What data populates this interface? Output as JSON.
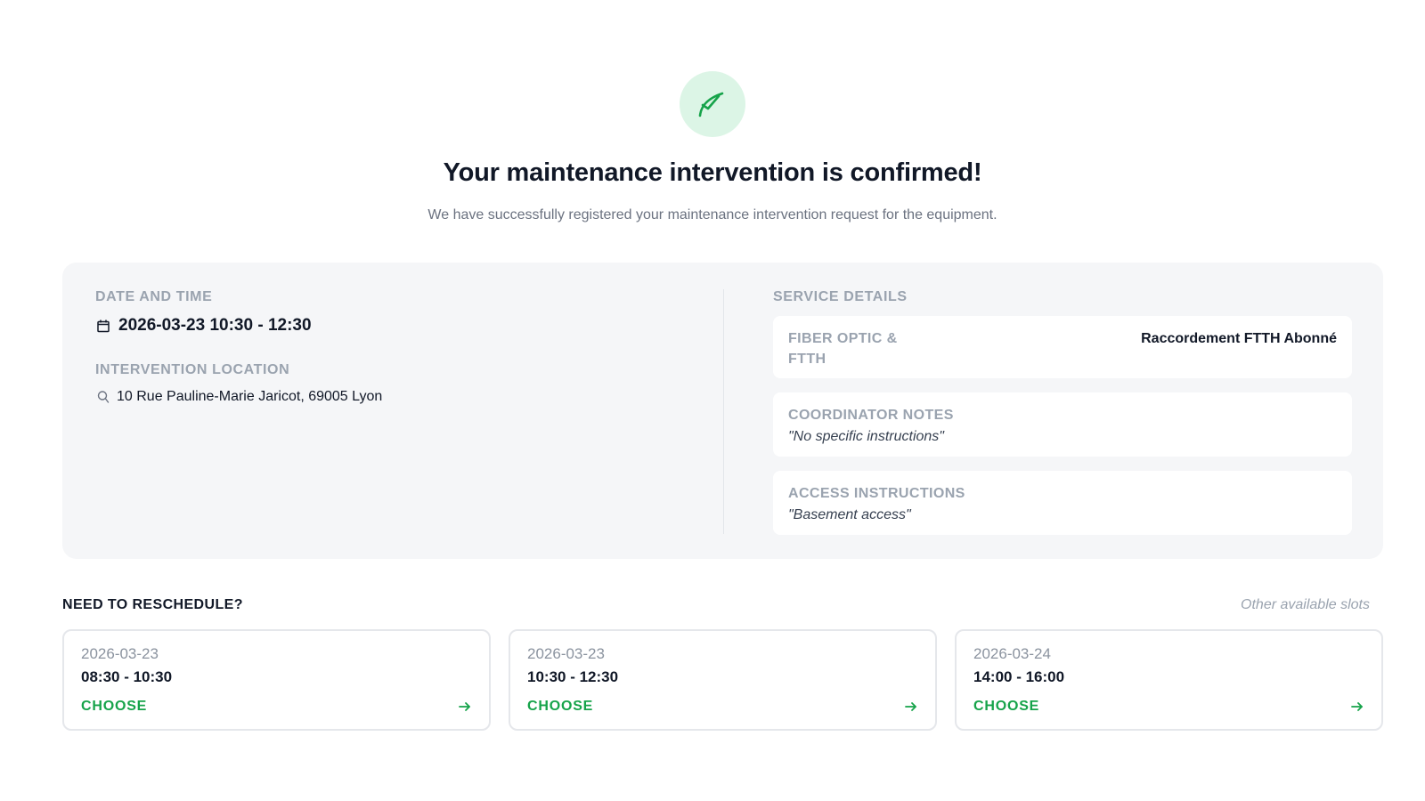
{
  "hero": {
    "icon": "check-leaf-icon",
    "title": "Your maintenance intervention is confirmed!",
    "subtitle": "We have successfully registered your maintenance intervention request for the equipment."
  },
  "summary": {
    "date_time": {
      "label": "DATE AND TIME",
      "icon": "calendar-icon",
      "value": "2026-03-23 10:30 - 12:30"
    },
    "location": {
      "label": "INTERVENTION LOCATION",
      "icon": "map-pin-icon",
      "value": "10 Rue Pauline-Marie Jaricot, 69005 Lyon"
    },
    "service": {
      "label": "SERVICE DETAILS",
      "service_type_label": "FIBER OPTIC & FTTH",
      "service_type_value": "Raccordement FTTH Abonné",
      "coordinator_label": "COORDINATOR NOTES",
      "coordinator_value": "\"No specific instructions\"",
      "access_label": "ACCESS INSTRUCTIONS",
      "access_value": "\"Basement access\""
    }
  },
  "reschedule": {
    "heading": "NEED TO RESCHEDULE?",
    "hint": "Other available slots",
    "slots": [
      {
        "date": "2026-03-23",
        "time": "08:30 - 10:30",
        "action": "CHOOSE"
      },
      {
        "date": "2026-03-23",
        "time": "10:30 - 12:30",
        "action": "CHOOSE"
      },
      {
        "date": "2026-03-24",
        "time": "14:00 - 16:00",
        "action": "CHOOSE"
      }
    ]
  },
  "colors": {
    "accent": "#16a34a",
    "badge_bg": "#dcf5e6",
    "card_bg": "#f5f6f8",
    "muted": "#9aa3af"
  }
}
